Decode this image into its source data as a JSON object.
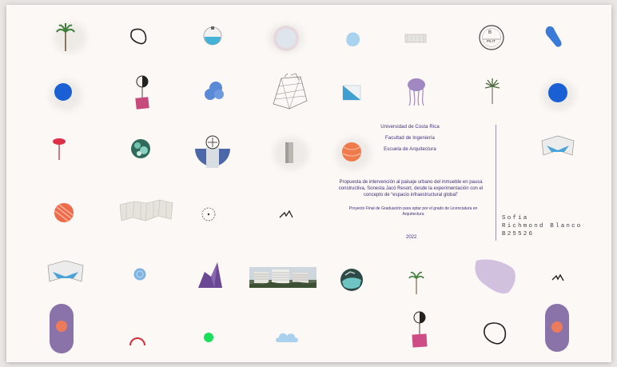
{
  "institution": {
    "university": "Universidad de Costa Rica",
    "faculty": "Facultad de Ingeniería",
    "school": "Escuela de Arquitectura"
  },
  "project": {
    "title": "Propuesta de intervención al paisaje urbano del inmueble en pausa constructiva, Sonesta Jacó Resort, desde la experimentación con el concepto de “espacio infraestructural global”",
    "subtitle": "Proyecto Final de Graduación para optar por el grado de Licenciatura en Arquitectura",
    "year": "2022"
  },
  "author": {
    "first_name": "Sofia",
    "last_name": "Richmond Blanco",
    "student_id": "B25526"
  },
  "stamp": {
    "top": "B",
    "bottom": "PILIT"
  },
  "colors": {
    "page_bg": "#fbf8f6",
    "text_accent": "#3b2f7a",
    "blue_dot": "#1a5fd4",
    "purple_blob": "#8a73a8",
    "orange_ball": "#ef7a4b",
    "green_dot": "#19e05a"
  },
  "icons": [
    "palm-tree-icon",
    "outline-blob-icon",
    "glass-bowl-icon",
    "pale-circle-icon",
    "sky-blob-icon",
    "white-arch-icon",
    "stamp-icon",
    "blue-shoe-icon",
    "blue-dot-icon",
    "parasol-icon",
    "blue-cloud-icon",
    "sketch-building-icon",
    "water-card-icon",
    "jellyfish-icon",
    "small-palm-icon",
    "red-mushroom-icon",
    "mosaic-circle-icon",
    "building-dome-icon",
    "concrete-column-icon",
    "orange-ball-icon",
    "folded-box-icon",
    "striped-ball-icon",
    "white-wall-icon",
    "crosshair-icon",
    "flower-icon",
    "purple-tent-icon",
    "resort-photo-icon",
    "pool-circle-icon",
    "purple-shape-icon",
    "bird-icon",
    "purple-capsule-icon",
    "red-arc-icon",
    "green-dot-icon",
    "cloud-icon"
  ]
}
